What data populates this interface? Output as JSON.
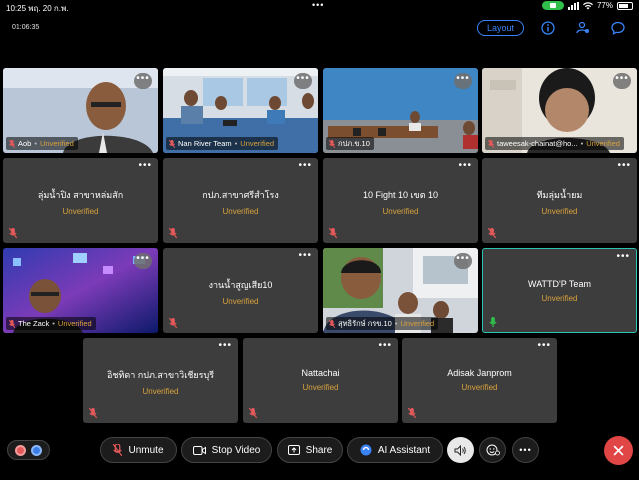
{
  "status_bar": {
    "time_date": "10:25 พฤ. 20 ก.พ.",
    "dots": "•••",
    "battery": "77%"
  },
  "meeting": {
    "elapsed": "01:06:35",
    "layout_label": "Layout"
  },
  "participants": [
    {
      "name": "Aob",
      "status": "Unverified",
      "video": true
    },
    {
      "name": "Nan River Team",
      "status": "Unverified",
      "video": true
    },
    {
      "name": "กปภ.ข.10",
      "status": "",
      "video": true
    },
    {
      "name": "taweesak-chainat@ho...",
      "status": "Unverified",
      "video": true
    },
    {
      "name": "ลุ่มน้ำปิง สาขาหล่มสัก",
      "status": "Unverified",
      "video": false
    },
    {
      "name": "กปภ.สาขาศรีสำโรง",
      "status": "Unverified",
      "video": false
    },
    {
      "name": "10 Fight 10 เขต 10",
      "status": "Unverified",
      "video": false
    },
    {
      "name": "ทีมลุ่มน้ำยม",
      "status": "Unverified",
      "video": false
    },
    {
      "name": "The Zack",
      "status": "Unverified",
      "video": true
    },
    {
      "name": "งานน้ำสูญเสีย10",
      "status": "Unverified",
      "video": false
    },
    {
      "name": "สุทธิรักษ์ กรข.10",
      "status": "Unverified",
      "video": true
    },
    {
      "name": "WATTD'P Team",
      "status": "Unverified",
      "video": false,
      "active": true
    },
    {
      "name": "อิชทิดา กปภ.สาขาวิเชียรบุรี",
      "status": "Unverified",
      "video": false
    },
    {
      "name": "Nattachai",
      "status": "Unverified",
      "video": false
    },
    {
      "name": "Adisak Janprom",
      "status": "Unverified",
      "video": false
    }
  ],
  "toolbar": {
    "unmute": "Unmute",
    "stop_video": "Stop Video",
    "share": "Share",
    "ai_assistant": "AI Assistant",
    "more": "•••"
  },
  "colors": {
    "accent": "#3a82f7",
    "unverified": "#d8a13c",
    "active_border": "#2ec3b6",
    "end_call": "#e14646",
    "muted": "#e4595a"
  }
}
